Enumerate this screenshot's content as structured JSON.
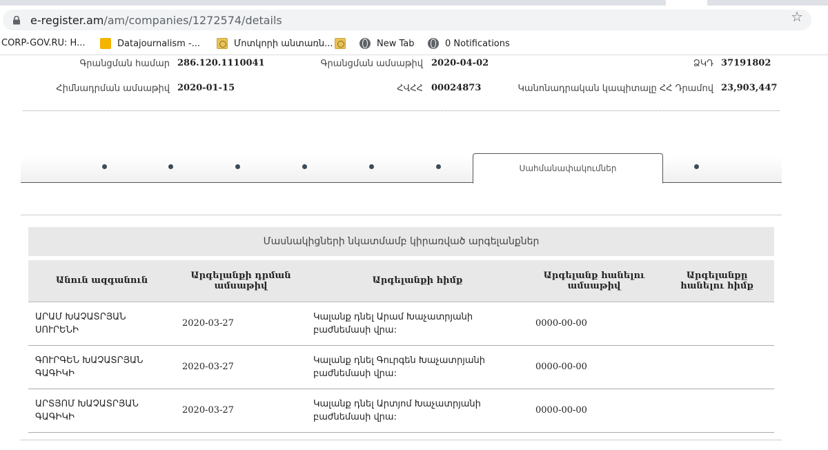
{
  "browser": {
    "url_host": "e-register.am",
    "url_path": "/am/companies/1272574/details",
    "bookmarks": [
      {
        "label": "CORP-GOV.RU: H...",
        "icon": "none"
      },
      {
        "label": "Datajournalism -...",
        "icon": "bookmark-yellow-icon"
      },
      {
        "label": "Մոտկորի անտառն...",
        "icon": "emblem-icon"
      },
      {
        "label": "",
        "icon": "emblem-icon"
      },
      {
        "label": "New Tab",
        "icon": "globe-icon"
      },
      {
        "label": "0 Notifications",
        "icon": "globe-icon"
      }
    ]
  },
  "company": {
    "reg_number_label": "Գրանցման համար",
    "reg_number": "286.120.1110041",
    "reg_date_label": "Գրանցման ամսաթիվ",
    "reg_date": "2020-04-02",
    "zkd_label": "ՁԿԴ",
    "zkd": "37191802",
    "founding_date_label": "Հիմնադրման ամսաթիվ",
    "founding_date": "2020-01-15",
    "tin_label": "ՀՎՀՀ",
    "tin": "00024873",
    "capital_label": "Կանոնադրական կապիտալը ՀՀ Դրամով",
    "capital": "23,903,447"
  },
  "tabs": {
    "active_label": "Սահմանափակումներ"
  },
  "restrictions": {
    "caption": "Մասնակիցների նկատմամբ կիրառված արգելանքներ",
    "headers": {
      "name": "Անուն ազգանուն",
      "apply_date": "Արգելանքի դրման ամսաթիվ",
      "basis": "Արգելանքի հիմք",
      "remove_date": "Արգելանք հանելու ամսաթիվ",
      "remove_basis": "Արգելանքը հանելու հիմք"
    },
    "rows": [
      {
        "name": "ԱՐԱՄ ԽԱՉԱՏՐՅԱՆ ՍՈՒՐԵՆԻ",
        "apply_date": "2020-03-27",
        "basis": "Կալանք դնել Արամ Խաչատրյանի բաժնեմասի վրա:",
        "remove_date": "0000-00-00",
        "remove_basis": ""
      },
      {
        "name": "ԳՈՒՐԳԵՆ ԽԱՉԱՏՐՅԱՆ ԳԱԳԻԿԻ",
        "apply_date": "2020-03-27",
        "basis": "Կալանք դնել Գուրգեն Խաչատրյանի բաժնեմասի վրա:",
        "remove_date": "0000-00-00",
        "remove_basis": ""
      },
      {
        "name": "ԱՐՏՅՈՄ ԽԱՉԱՏՐՅԱՆ ԳԱԳԻԿԻ",
        "apply_date": "2020-03-27",
        "basis": "Կալանք դնել Արտյոմ Խաչատրյանի բաժնեմասի վրա:",
        "remove_date": "0000-00-00",
        "remove_basis": ""
      }
    ]
  }
}
